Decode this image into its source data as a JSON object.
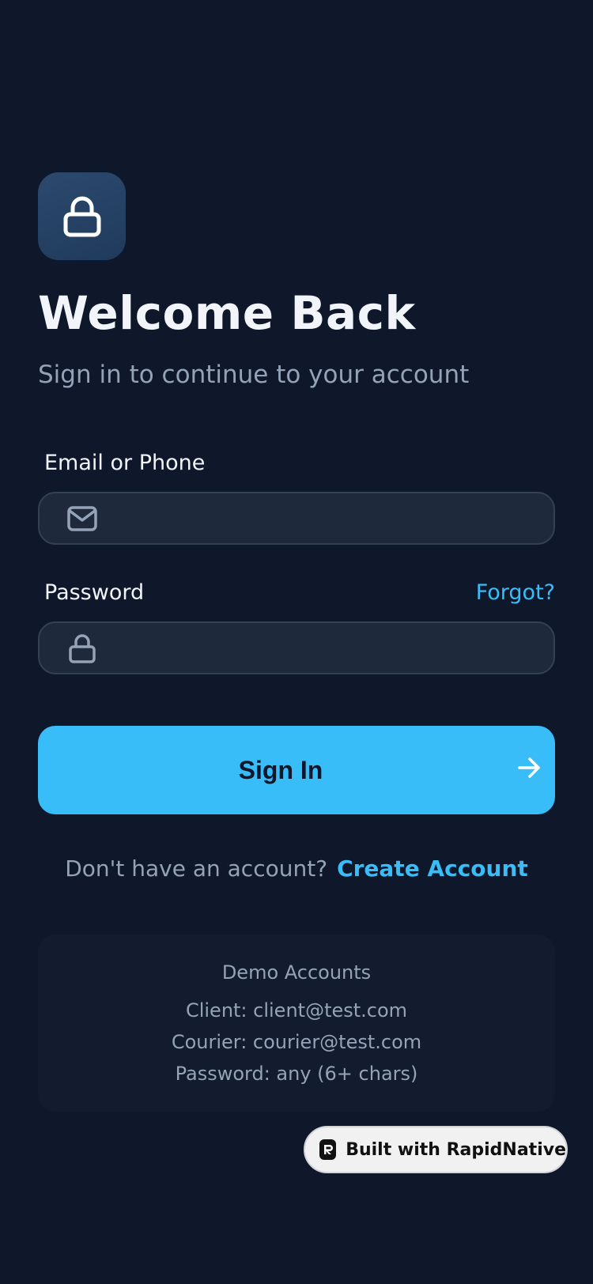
{
  "header": {
    "title": "Welcome Back",
    "subtitle": "Sign in to continue to your account",
    "logo_icon": "lock-icon"
  },
  "form": {
    "email": {
      "label": "Email or Phone",
      "value": "",
      "placeholder": "",
      "icon": "mail-icon"
    },
    "password": {
      "label": "Password",
      "value": "",
      "placeholder": "",
      "icon": "lock-icon",
      "forgot_label": "Forgot?"
    },
    "submit_label": "Sign In",
    "submit_icon": "arrow-right-icon"
  },
  "signup": {
    "prompt": "Don't have an account?",
    "link_label": "Create Account"
  },
  "demo": {
    "title": "Demo Accounts",
    "lines": [
      "Client: client@test.com",
      "Courier: courier@test.com",
      "Password: any (6+ chars)"
    ]
  },
  "badge": {
    "label": "Built with RapidNative"
  },
  "colors": {
    "background": "#0f172a",
    "accent": "#38bdf8",
    "field_bg": "#1e293b",
    "muted_text": "#94a3b8"
  }
}
